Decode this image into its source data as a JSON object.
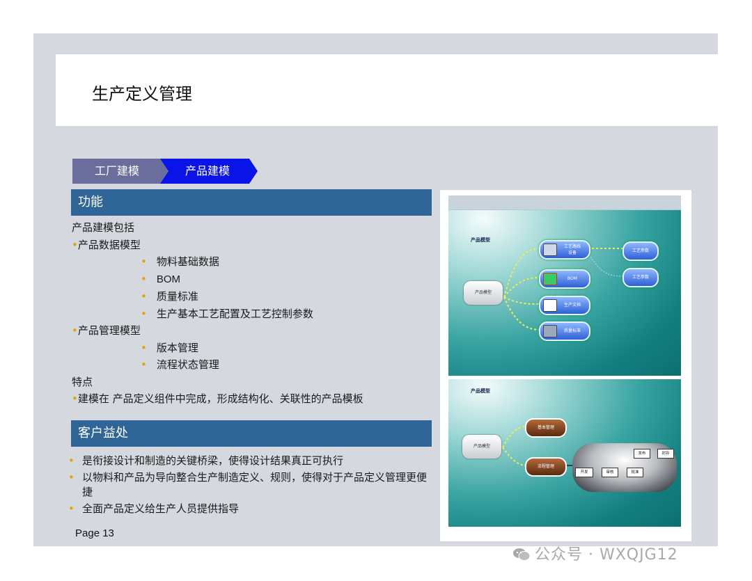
{
  "slide": {
    "title": "生产定义管理",
    "tabs": [
      "工厂建模",
      "产品建模"
    ],
    "function_section": {
      "heading": "功能",
      "lines": [
        {
          "level": 0,
          "bullet": false,
          "text": "产品建模包括"
        },
        {
          "level": 0,
          "bullet": true,
          "text": "产品数据模型"
        },
        {
          "level": 1,
          "bullet": true,
          "text": "物料基础数据"
        },
        {
          "level": 1,
          "bullet": true,
          "text": "BOM"
        },
        {
          "level": 1,
          "bullet": true,
          "text": "质量标准"
        },
        {
          "level": 1,
          "bullet": true,
          "text": "生产基本工艺配置及工艺控制参数"
        },
        {
          "level": 0,
          "bullet": true,
          "text": "产品管理模型"
        },
        {
          "level": 1,
          "bullet": true,
          "text": "版本管理"
        },
        {
          "level": 1,
          "bullet": true,
          "text": "流程状态管理"
        },
        {
          "level": 0,
          "bullet": false,
          "text": "特点"
        },
        {
          "level": 0,
          "bullet": true,
          "text": "建模在 产品定义组件中完成，形成结构化、关联性的产品模板"
        }
      ]
    },
    "benefits_section": {
      "heading": "客户益处",
      "items": [
        "是衔接设计和制造的关键桥梁，使得设计结果真正可执行",
        "以物料和产品为导向整合生产制造定义、规则，使得对于产品定义管理更便捷",
        "全面产品定义给生产人员提供指导"
      ]
    },
    "page_number": "Page 13"
  },
  "diagram_top": {
    "label": "产品模型",
    "root": "产品模型",
    "nodes": [
      "工艺路线\n设备",
      "BOM",
      "生产文档",
      "质量标准"
    ],
    "params": [
      "工艺参数",
      "工艺参数"
    ]
  },
  "diagram_bottom": {
    "label": "产品模型",
    "root": "产品模型",
    "nodes": [
      "基本管理",
      "流程管理"
    ],
    "flow": [
      "开发",
      "审核",
      "批准",
      "发布",
      "封存"
    ]
  },
  "watermark": "公众号 · WXQJG12"
}
